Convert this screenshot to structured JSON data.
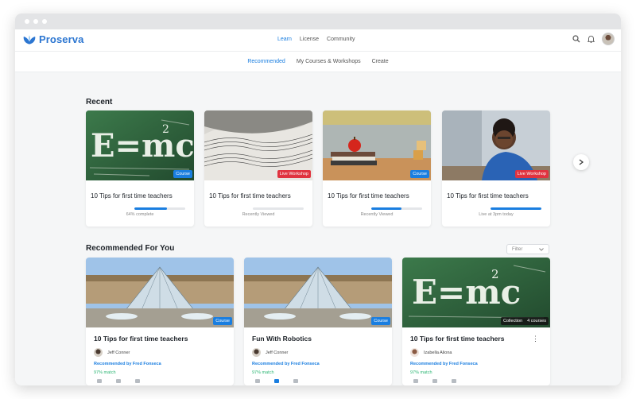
{
  "app": {
    "name": "Proserva"
  },
  "topnav": {
    "items": [
      "Learn",
      "License",
      "Community"
    ],
    "active": "Learn"
  },
  "subnav": {
    "items": [
      "Recommended",
      "My Courses & Workshops",
      "Create"
    ],
    "active": "Recommended"
  },
  "recent": {
    "title": "Recent",
    "cards": [
      {
        "title": "10 Tips for first time teachers",
        "badge": "Course",
        "progress": 0.64,
        "status": "64% complete",
        "thumb": "chalkboard"
      },
      {
        "title": "10 Tips for first time teachers",
        "badge": "Live Workshop",
        "progress": 0,
        "status": "Recently Viewed",
        "thumb": "sheet-music"
      },
      {
        "title": "10 Tips for first time teachers",
        "badge": "Course",
        "progress": 0.6,
        "status": "Recently Viewed",
        "thumb": "apple-books"
      },
      {
        "title": "10 Tips for first time teachers",
        "badge": "Live Workshop",
        "progress": 1.0,
        "status": "Live at 3pm today",
        "thumb": "teacher"
      }
    ]
  },
  "recommended": {
    "title": "Recommended For You",
    "filter_label": "Filter",
    "cards": [
      {
        "title": "10 Tips for first time teachers",
        "badge": "Course",
        "author": "Jeff Conner",
        "recommended_by": "Recommended by Fred Fonseca",
        "match": "97% match",
        "thumb": "louvre"
      },
      {
        "title": "Fun With Robotics",
        "badge": "Course",
        "author": "Jeff Conner",
        "recommended_by": "Recommended by Fred Fonseca",
        "match": "97% match",
        "thumb": "louvre"
      },
      {
        "title": "10 Tips for first time teachers",
        "badge": "Collection",
        "badge_count": "4 courses",
        "author": "Izabella Aliona",
        "recommended_by": "Recommended by Fred Fonseca",
        "match": "97% match",
        "thumb": "chalkboard"
      }
    ]
  },
  "colors": {
    "accent": "#1a7ee0",
    "live": "#e0333f",
    "match": "#2bb673",
    "logo": "#2c76d1"
  }
}
